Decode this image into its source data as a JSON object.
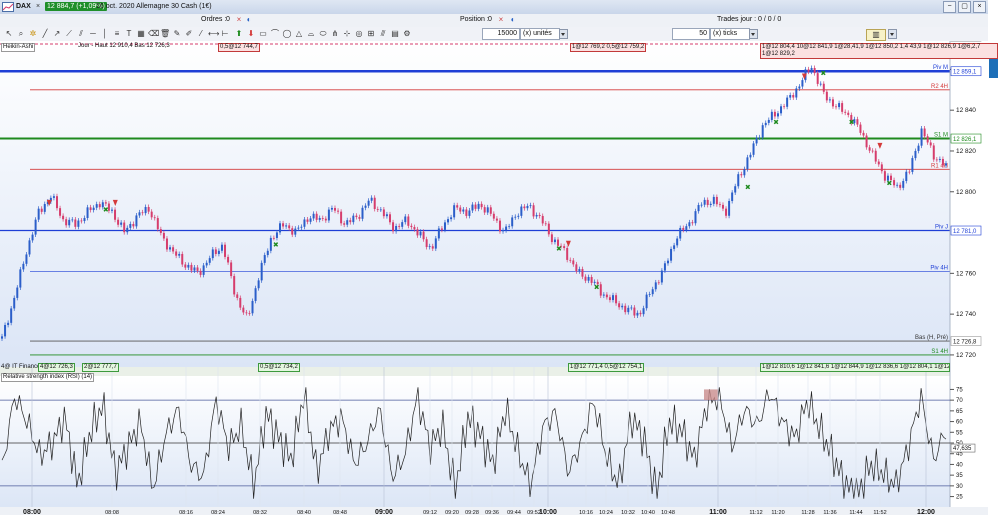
{
  "titlebar": {
    "symbol": "DAX",
    "close_glyph": "×",
    "price_badge": "12 884,7 (+1,09%)",
    "description": "16 oct. 2020 Allemagne 30 Cash (1€)",
    "win_buttons": [
      "−",
      "▢",
      "×"
    ]
  },
  "toolbar": {
    "orders_label": "Ordres :",
    "orders_value": "0",
    "position_label": "Position :",
    "position_value": "0",
    "trades_label": "Trades jour : 0 / 0 / 0"
  },
  "toolbar2": {
    "qty_value": "15000",
    "qty_unit": "(x) unités",
    "ticks_value": "50",
    "ticks_unit": "(x) ticks"
  },
  "colors": {
    "up": "#2b5ec9",
    "down": "#d63d6c",
    "pivot_blue": "#1f3fd6",
    "green_line": "#1e8a1e",
    "red_line": "#d43a3a"
  },
  "main_chart": {
    "indicator_label": "Heikin-Ashi",
    "header_text": "Jour - Haut 12 910,4 Bas 12 726,3",
    "price_ticks": [
      "12 84",
      "12 840",
      "12 820",
      "12 800",
      "12 760",
      "12 740",
      "12 720"
    ],
    "price_ticks_values": [
      12860,
      12840,
      12820,
      12800,
      12760,
      12740,
      12720
    ],
    "price_boxes": [
      {
        "text": "12 884,7",
        "price": 12884.7,
        "kind": "last"
      },
      {
        "text": "+1,09%",
        "price": 12876,
        "kind": "pct"
      },
      {
        "text": "12 868,7",
        "price": 12868.7,
        "kind": "plain"
      },
      {
        "text": "12 859,1",
        "price": 12859.1,
        "kind": "blue"
      },
      {
        "text": "12 826,1",
        "price": 12826.1,
        "kind": "green"
      },
      {
        "text": "12 781,0",
        "price": 12781.0,
        "kind": "blue"
      },
      {
        "text": "12 726,8",
        "price": 12726.8,
        "kind": "plain"
      }
    ],
    "level_labels": [
      {
        "text": "Piv M",
        "price": 12859.1,
        "color": "#1f3fd6"
      },
      {
        "text": "R2 4H",
        "price": 12850,
        "color": "#d43a3a"
      },
      {
        "text": "S1 M",
        "price": 12826.1,
        "color": "#1e8a1e"
      },
      {
        "text": "R1 4H",
        "price": 12811,
        "color": "#d43a3a"
      },
      {
        "text": "Piv J",
        "price": 12781,
        "color": "#1f3fd6"
      },
      {
        "text": "Piv 4H",
        "price": 12761,
        "color": "#1f3fd6"
      },
      {
        "text": "Bas (H, Pré)",
        "price": 12726.8,
        "color": "#333"
      },
      {
        "text": "S1 4H",
        "price": 12720,
        "color": "#1e8a1e"
      }
    ],
    "top_tags": [
      {
        "text": "0,5@12 744,7",
        "color": "red"
      },
      {
        "text": "1@12 769,2 0,5@12 759,2",
        "color": "red"
      },
      {
        "text": "1@12 804,4 10@12 841,9 1@28,41,9 1@12 850,2 1,4 43,9 1@12 826,9 1@6,2,7 1@12 829,2",
        "color": "red"
      }
    ]
  },
  "mid_band": {
    "left_text": "4@ IT Finance indicateur",
    "tags": [
      "4@12 726,3",
      "2@12 777,7",
      "0,5@12 734,2",
      "1@12 771,4 0,5@12 754,1",
      "1@12 810,6 1@12 841,6 1@12 844,9 1@12 836,6 1@12 804,1 1@12 809,9 1@12 829,2"
    ]
  },
  "rsi": {
    "title": "Relative strength index (RSI) (14)",
    "ticks": [
      "75",
      "70",
      "65",
      "60",
      "55",
      "50",
      "45",
      "40",
      "35",
      "30",
      "25"
    ],
    "ticks_values": [
      75,
      70,
      65,
      60,
      55,
      50,
      45,
      40,
      35,
      30,
      25
    ],
    "value_box": "47,635",
    "value": 47.635,
    "levels": [
      70,
      50,
      30
    ]
  },
  "time_axis": {
    "labels": [
      "08:00",
      "08:08",
      "08:16",
      "08:24",
      "08:32",
      "08:40",
      "08:48",
      "09:00",
      "09:12",
      "09:20",
      "09:28",
      "09:36",
      "09:44",
      "09:52",
      "10:00",
      "10:16",
      "10:24",
      "10:32",
      "10:40",
      "10:48",
      "11:00",
      "11:12",
      "11:20",
      "11:28",
      "11:36",
      "11:44",
      "11:52",
      "12:00"
    ],
    "bold": [
      "08:00",
      "09:00",
      "10:00",
      "11:00",
      "12:00"
    ]
  },
  "chart_data": {
    "type": "line",
    "title": "",
    "xlabel": "",
    "ylabel": "",
    "ylim": [
      12718,
      12870
    ],
    "series": [
      {
        "values": [
          12728,
          12748,
          12771,
          12790,
          12798,
          12786,
          12784,
          12790,
          12795,
          12790,
          12780,
          12788,
          12792,
          12778,
          12770,
          12764,
          12760,
          12768,
          12774,
          12750,
          12737,
          12760,
          12778,
          12784,
          12780,
          12788,
          12786,
          12792,
          12784,
          12788,
          12796,
          12790,
          12782,
          12786,
          12779,
          12772,
          12784,
          12792,
          12790,
          12794,
          12788,
          12780,
          12790,
          12793,
          12786,
          12776,
          12770,
          12760,
          12757,
          12750,
          12746,
          12742,
          12740,
          12752,
          12762,
          12778,
          12784,
          12794,
          12796,
          12790,
          12806,
          12818,
          12832,
          12838,
          12844,
          12852,
          12862,
          12848,
          12842,
          12838,
          12830,
          12818,
          12808,
          12802,
          12810,
          12830,
          12818,
          12812
        ]
      }
    ],
    "rsi_values": [
      38,
      72,
      60,
      44,
      50,
      62,
      30,
      55,
      68,
      36,
      48,
      60,
      28,
      54,
      66,
      40,
      34,
      70,
      48,
      58,
      30,
      64,
      52,
      42,
      74,
      36,
      56,
      62,
      40,
      50,
      66,
      34,
      44,
      72,
      48,
      58,
      28,
      62,
      54,
      40,
      66,
      46,
      30,
      58,
      64,
      36,
      50,
      70,
      44,
      30,
      62,
      52,
      26,
      60,
      56,
      42,
      68,
      72,
      48,
      66,
      58,
      74,
      60,
      52,
      70,
      56,
      44,
      30,
      26,
      40,
      36,
      30,
      48,
      72,
      42,
      56
    ]
  }
}
